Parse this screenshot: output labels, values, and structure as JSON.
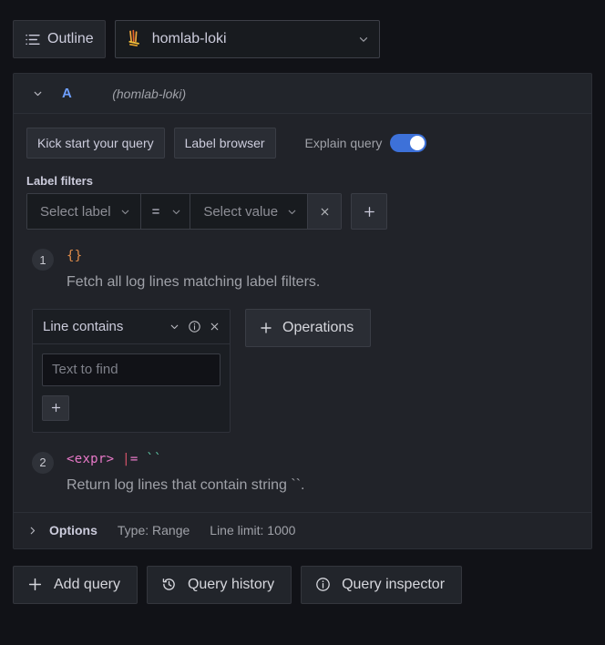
{
  "topbar": {
    "outline_button": "Outline",
    "outline_icon": "list-icon",
    "datasource": {
      "name": "homlab-loki",
      "logo_icon": "loki-logo-icon",
      "chevron_icon": "chevron-down-icon"
    }
  },
  "query": {
    "collapse_icon": "chevron-down-icon",
    "ref_id": "A",
    "datasource_label": "(homlab-loki)",
    "toolbar": {
      "kick_start": "Kick start your query",
      "label_browser": "Label browser",
      "explain_label": "Explain query",
      "explain_enabled": true
    },
    "label_filters": {
      "title": "Label filters",
      "label_placeholder": "Select label",
      "operator": "=",
      "value_placeholder": "Select value",
      "remove_icon": "close-icon",
      "add_icon": "plus-icon"
    },
    "explanations": [
      {
        "step": "1",
        "code_plain": "{}",
        "description": "Fetch all log lines matching label filters."
      },
      {
        "step": "2",
        "code_plain": "<expr> |= ``",
        "code_parts": {
          "expr": "<expr>",
          "pipe": "|",
          "eq": "=",
          "string": "``"
        },
        "description": "Return log lines that contain string ``."
      }
    ],
    "operation_card": {
      "title": "Line contains",
      "chevron_icon": "chevron-down-icon",
      "info_icon": "info-circle-icon",
      "close_icon": "close-icon",
      "input_placeholder": "Text to find",
      "input_value": "",
      "add_icon": "plus-icon"
    },
    "operations_button": {
      "label": "Operations",
      "icon": "plus-icon"
    },
    "options": {
      "expand_icon": "chevron-right-icon",
      "title": "Options",
      "type": "Type: Range",
      "line_limit": "Line limit: 1000"
    }
  },
  "bottombar": {
    "add_query": {
      "label": "Add query",
      "icon": "plus-icon"
    },
    "query_history": {
      "label": "Query history",
      "icon": "history-icon"
    },
    "query_inspector": {
      "label": "Query inspector",
      "icon": "info-circle-icon"
    }
  },
  "colors": {
    "page_bg": "#111217",
    "panel_bg": "#212329",
    "accent_blue": "#3d71d9",
    "ref_id_blue": "#6e9fff",
    "code_orange": "#e08c4a",
    "code_pink": "#e879c8",
    "code_red": "#d7536a",
    "code_green": "#5ec9a6"
  }
}
